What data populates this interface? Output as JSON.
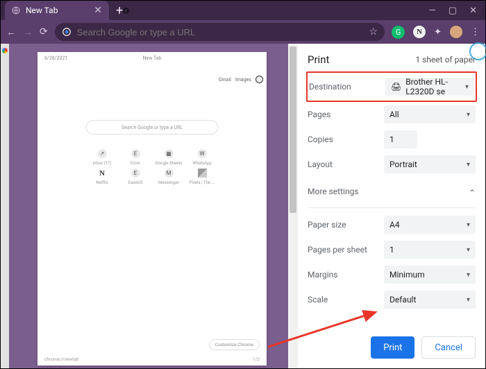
{
  "titlebar": {
    "tab_title": "New Tab",
    "new_tab_glyph": "+",
    "min": "—",
    "max": "▢",
    "close": "✕"
  },
  "address": {
    "back": "←",
    "fwd": "→",
    "reload": "⟳",
    "placeholder": "Search Google or type a URL",
    "star": "☆",
    "grammarly": "G",
    "notion": "N",
    "puzzle": "✦",
    "overflow": "⋮"
  },
  "preview": {
    "date": "6/28/2021",
    "title": "New Tab",
    "gmail": "Gmail",
    "images": "Images",
    "search_placeholder": "Search Google or type a URL",
    "shortcuts": [
      {
        "icon": "↗",
        "label": "Inbox (17)"
      },
      {
        "icon": "E",
        "label": "Ezoic"
      },
      {
        "icon": "▦",
        "label": "Google Sheets"
      },
      {
        "icon": "W",
        "label": "WhatsApp"
      },
      {
        "icon": "N",
        "label": "Netflix",
        "cls": "net"
      },
      {
        "icon": "E",
        "label": "EaseUS"
      },
      {
        "icon": "M",
        "label": "Messenger"
      },
      {
        "icon": "",
        "label": "Pixels | The ...",
        "cls": "pix"
      }
    ],
    "customize": "Customize Chrome",
    "footer_url": "chrome://newtab",
    "page_no": "1/2"
  },
  "print": {
    "title": "Print",
    "sheets": "1 sheet of paper",
    "rows": {
      "destination": {
        "label": "Destination",
        "value": "Brother HL-L2320D se",
        "icon": "🖨"
      },
      "pages": {
        "label": "Pages",
        "value": "All"
      },
      "copies": {
        "label": "Copies",
        "value": "1"
      },
      "layout": {
        "label": "Layout",
        "value": "Portrait"
      },
      "more": {
        "label": "More settings"
      },
      "papersize": {
        "label": "Paper size",
        "value": "A4"
      },
      "pps": {
        "label": "Pages per sheet",
        "value": "1"
      },
      "margins": {
        "label": "Margins",
        "value": "Minimum"
      },
      "scale": {
        "label": "Scale",
        "value": "Default"
      }
    },
    "buttons": {
      "print": "Print",
      "cancel": "Cancel"
    },
    "caret_down": "▾",
    "caret_up": "⌃"
  }
}
